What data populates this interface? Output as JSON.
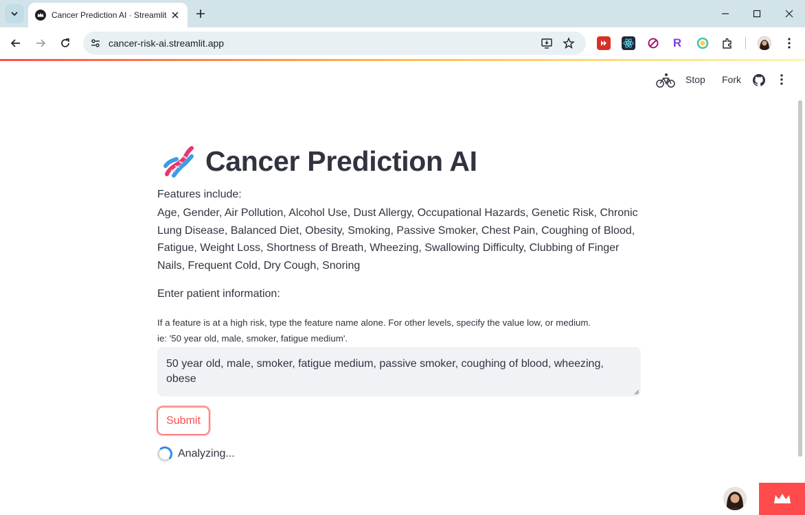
{
  "browser": {
    "tab_title": "Cancer Prediction AI · Streamlit",
    "url": "cancer-risk-ai.streamlit.app"
  },
  "streamlit_header": {
    "stop_label": "Stop",
    "fork_label": "Fork"
  },
  "page": {
    "title": "Cancer Prediction AI",
    "features_label": "Features include:",
    "features_text": "Age, Gender, Air Pollution, Alcohol Use, Dust Allergy, Occupational Hazards, Genetic Risk, Chronic Lung Disease, Balanced Diet, Obesity, Smoking, Passive Smoker, Chest Pain, Coughing of Blood, Fatigue, Weight Loss, Shortness of Breath, Wheezing, Swallowing Difficulty, Clubbing of Finger Nails, Frequent Cold, Dry Cough, Snoring",
    "enter_label": "Enter patient information:",
    "help_line1": "If a feature is at a high risk, type the feature name alone. For other levels, specify the value low, or medium.",
    "help_line2": "ie: '50 year old, male, smoker, fatigue medium'.",
    "input_value": "50 year old, male, smoker, fatigue medium, passive smoker, coughing of blood, wheezing, obese",
    "submit_label": "Submit",
    "status_text": "Analyzing..."
  },
  "colors": {
    "accent": "#ff4b4b",
    "text": "#31333f",
    "input_bg": "#f0f2f6",
    "spinner": "#2e8bf0"
  }
}
